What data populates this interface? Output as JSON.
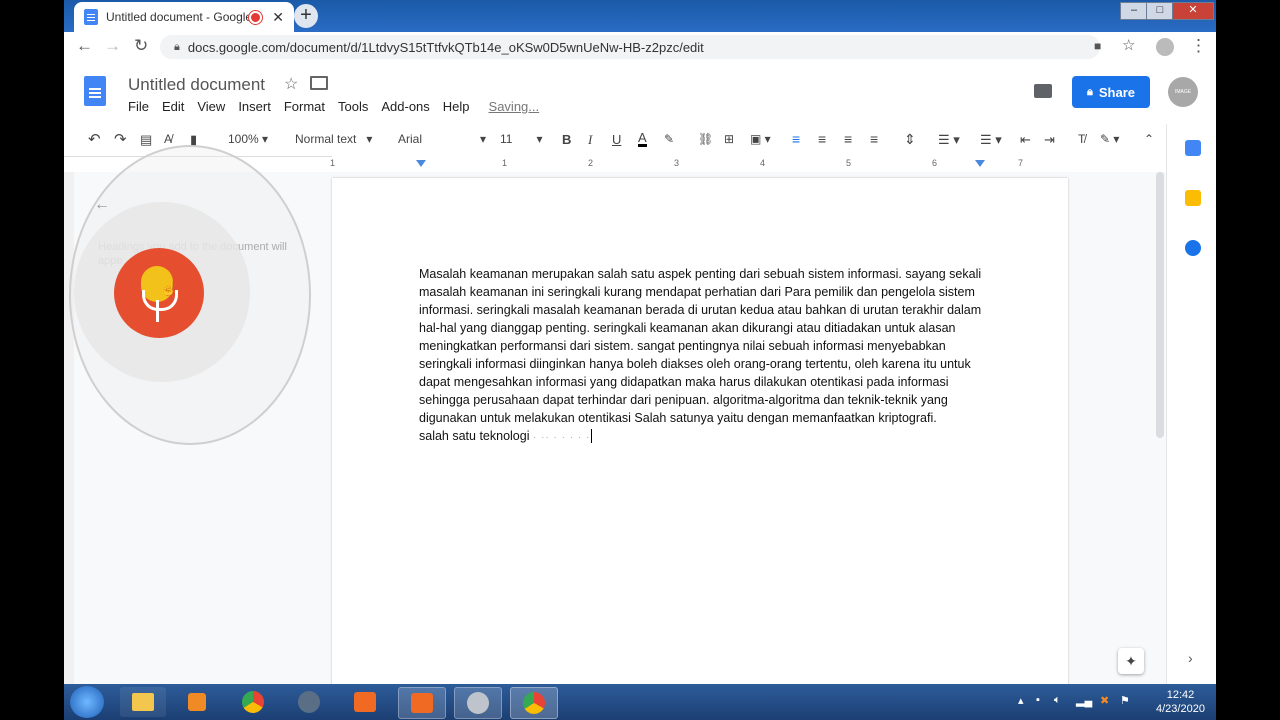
{
  "browser": {
    "tab_title": "Untitled document - Google",
    "url": "docs.google.com/document/d/1LtdvyS15tTtfvkQTb14e_oKSw0D5wnUeNw-HB-z2pzc/edit",
    "new_tab": "+",
    "tab_close": "✕"
  },
  "docs": {
    "title": "Untitled document",
    "menus": [
      "File",
      "Edit",
      "View",
      "Insert",
      "Format",
      "Tools",
      "Add-ons",
      "Help"
    ],
    "saving": "Saving...",
    "share_label": "Share",
    "avatar_text": "IMAGE"
  },
  "toolbar": {
    "zoom": "100%",
    "style": "Normal text",
    "font": "Arial",
    "size": "11",
    "bold": "B",
    "italic": "I",
    "underline": "U",
    "text_color": "A"
  },
  "ruler": {
    "marks": [
      "1",
      "1",
      "2",
      "3",
      "4",
      "5",
      "6",
      "7"
    ]
  },
  "outline": {
    "hint": "Headings you add to the document will appe..."
  },
  "document": {
    "paragraph1": "Masalah keamanan merupakan salah satu aspek penting dari sebuah sistem informasi.  sayang sekali masalah keamanan ini seringkali kurang mendapat perhatian dari Para pemilik dan pengelola sistem informasi.  seringkali masalah keamanan berada di urutan kedua atau bahkan di urutan terakhir dalam hal-hal yang dianggap penting.  seringkali keamanan akan dikurangi atau ditiadakan untuk alasan meningkatkan performansi dari sistem.  sangat pentingnya nilai sebuah informasi menyebabkan seringkali informasi diinginkan hanya boleh diakses oleh orang-orang tertentu, oleh karena itu untuk dapat mengesahkan informasi yang didapatkan maka harus dilakukan otentikasi pada informasi sehingga perusahaan dapat terhindar dari penipuan.  algoritma-algoritma dan teknik-teknik yang digunakan untuk melakukan otentikasi Salah satunya yaitu dengan memanfaatkan kriptografi.",
    "paragraph2": " salah satu teknologi"
  },
  "taskbar": {
    "time": "12:42",
    "date": "4/23/2020"
  },
  "colors": {
    "accent": "#1a73e8",
    "mic": "#e54f2f",
    "mic_body": "#f2c21b"
  }
}
